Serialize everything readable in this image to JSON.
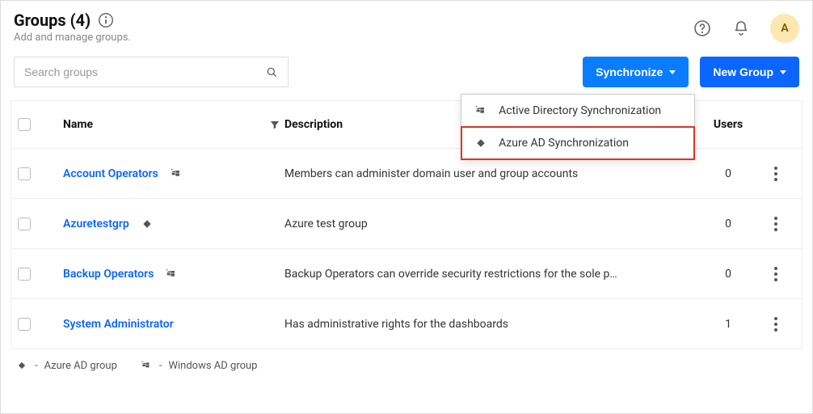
{
  "header": {
    "title": "Groups (4)",
    "subtitle": "Add and manage groups.",
    "avatar_initial": "A"
  },
  "search": {
    "placeholder": "Search groups"
  },
  "buttons": {
    "synchronize": "Synchronize",
    "new_group": "New Group"
  },
  "dropdown": {
    "items": [
      {
        "label": "Active Directory Synchronization",
        "icon": "windows-ad-icon"
      },
      {
        "label": "Azure AD Synchronization",
        "icon": "azure-ad-icon"
      }
    ]
  },
  "table": {
    "headers": {
      "name": "Name",
      "description": "Description",
      "users": "Users"
    },
    "rows": [
      {
        "name": "Account Operators",
        "icon": "windows-ad-icon",
        "description": "Members can administer domain user and group accounts",
        "users": "0"
      },
      {
        "name": "Azuretestgrp",
        "icon": "azure-ad-icon",
        "description": "Azure test group",
        "users": "0"
      },
      {
        "name": "Backup Operators",
        "icon": "windows-ad-icon",
        "description": "Backup Operators can override security restrictions for the sole p…",
        "users": "0"
      },
      {
        "name": "System Administrator",
        "icon": "",
        "description": "Has administrative rights for the dashboards",
        "users": "1"
      }
    ]
  },
  "legend": {
    "azure": "Azure AD group",
    "windows": "Windows AD group",
    "dash": "-"
  }
}
